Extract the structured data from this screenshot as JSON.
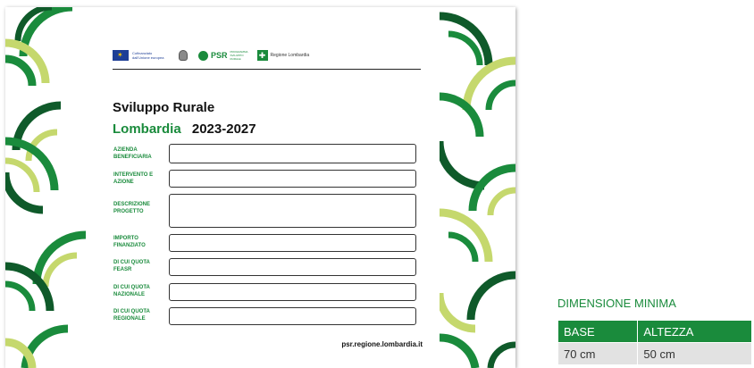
{
  "logos": {
    "eu_text": "Cofinanziato dall'Unione europea",
    "psr": "PSR",
    "psr_sub": "PROGRAMMA SVILUPPO RURALE",
    "lombardia": "Regione Lombardia"
  },
  "title": {
    "line1": "Sviluppo Rurale",
    "region": "Lombardia",
    "years": "2023-2027"
  },
  "form": {
    "fields": [
      {
        "label": "AZIENDA BENEFICIARIA"
      },
      {
        "label": "INTERVENTO E AZIONE"
      },
      {
        "label": "DESCRIZIONE PROGETTO"
      },
      {
        "label": "IMPORTO FINANZIATO"
      },
      {
        "label": "DI CUI QUOTA FEASR"
      },
      {
        "label": "DI CUI QUOTA NAZIONALE"
      },
      {
        "label": "DI CUI QUOTA REGIONALE"
      }
    ]
  },
  "footer_url": "psr.regione.lombardia.it",
  "dimensions": {
    "title": "DIMENSIONE MINIMA",
    "headers": [
      "BASE",
      "ALTEZZA"
    ],
    "values": [
      "70 cm",
      "50 cm"
    ]
  },
  "colors": {
    "brand_green": "#1a8b3c",
    "light_green": "#c5d86d"
  }
}
